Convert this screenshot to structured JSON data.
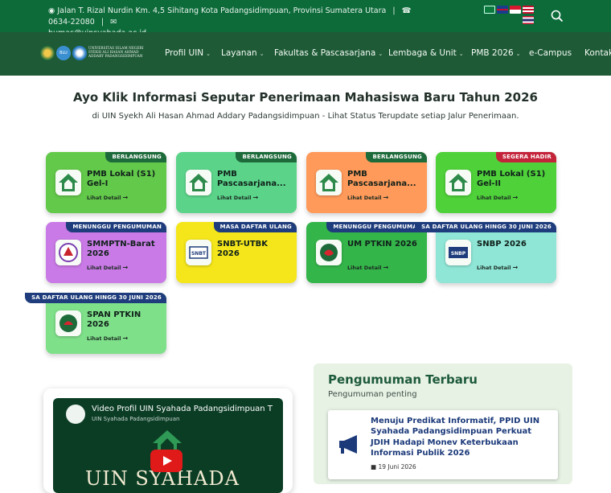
{
  "topbar": {
    "address": "Jalan T. Rizal Nurdin Km. 4,5 Sihitang Kota Padangsidimpuan, Provinsi Sumatera Utara",
    "separator": "|",
    "phone": "0634-22080",
    "email": "humas@uinsyahada.ac.id"
  },
  "logo": {
    "text": "UNIVERSITAS ISLAM NEGERI SYEKH ALI HASAN AHMAD ADDARY PADANGSIDIMPUAN",
    "blu": "BLU"
  },
  "nav": {
    "items": [
      {
        "label": "Profil UIN",
        "dropdown": true
      },
      {
        "label": "Layanan",
        "dropdown": true
      },
      {
        "label": "Fakultas & Pascasarjana",
        "dropdown": true
      },
      {
        "label": "Lembaga & Unit",
        "dropdown": true
      },
      {
        "label": "PMB 2026",
        "dropdown": true
      },
      {
        "label": "e-Campus",
        "dropdown": false
      },
      {
        "label": "Kontak",
        "dropdown": false
      }
    ]
  },
  "hero": {
    "title": "Ayo Klik Informasi Seputar Penerimaan Mahasiswa Baru Tahun 2026",
    "subtitle": "di UIN Syekh Ali Hasan Ahmad Addary Padangsidimpuan - Lihat Status Terupdate setiap Jalur Penerimaan."
  },
  "cards": [
    {
      "title": "PMB Lokal (S1) Gel-I",
      "badge": "BERLANGSUNG",
      "link": "Lihat Detail",
      "bg": "#63c94a",
      "badge_bg": "#1d6a3a",
      "icon": "uin-logo-icon"
    },
    {
      "title": "PMB Pascasarjana...",
      "badge": "BERLANGSUNG",
      "link": "Lihat Detail",
      "bg": "#5bd48a",
      "badge_bg": "#1d6a3a",
      "icon": "uin-logo-icon"
    },
    {
      "title": "PMB Pascasarjana...",
      "badge": "BERLANGSUNG",
      "link": "Lihat Detail",
      "bg": "#ff9a5a",
      "badge_bg": "#1d6a3a",
      "icon": "uin-logo-icon"
    },
    {
      "title": "PMB Lokal (S1) Gel-II",
      "badge": "SEGERA HADIR",
      "link": "Lihat Detail",
      "bg": "#4fd13a",
      "badge_bg": "#c4243a",
      "icon": "uin-logo-icon"
    },
    {
      "title": "SMMPTN-Barat 2026",
      "badge": "MENUNGGU PENGUMUMAN",
      "link": "Lihat Detail",
      "bg": "#c97ae6",
      "badge_bg": "#1f3d7c",
      "icon": "smmptn-logo-icon"
    },
    {
      "title": "SNBT-UTBK 2026",
      "badge": "MASA DAFTAR ULANG",
      "link": "",
      "bg": "#f4e61a",
      "badge_bg": "#1f3d7c",
      "icon": "snbt-logo-icon"
    },
    {
      "title": "UM PTKIN 2026",
      "badge": "MENUNGGU PENGUMUMAN",
      "link": "Lihat Detail",
      "bg": "#34b54a",
      "badge_bg": "#1f3d7c",
      "icon": "umptkin-logo-icon"
    },
    {
      "title": "SNBP 2026",
      "badge": "SA DAFTAR ULANG HINGG 30 JUNI 2026",
      "link": "Lihat Detail",
      "bg": "#8fe6d6",
      "badge_bg": "#1f3d7c",
      "icon": "snbp-logo-icon"
    },
    {
      "title": "SPAN PTKIN 2026",
      "badge": "SA DAFTAR ULANG HINGG 30 JUNI 2026",
      "link": "Lihat Detail",
      "bg": "#7fe08a",
      "badge_bg": "#1f3d7c",
      "icon": "span-logo-icon"
    }
  ],
  "video": {
    "title": "Video Profil UIN Syahada Padangsidimpuan T",
    "channel": "UIN Syahada Padangsidimpuan",
    "overlay_text": "UIN SYAHADA"
  },
  "announcements": {
    "heading": "Pengumuman Terbaru",
    "subheading": "Pengumuman penting",
    "items": [
      {
        "title": "Menuju Predikat Informatif, PPID UIN Syahada Padangsidimpuan Perkuat JDIH Hadapi Monev Keterbukaan Informasi Publik 2026",
        "date": "19 Juni 2026"
      }
    ]
  },
  "colors": {
    "topbar": "#0d6b3a",
    "navbar": "#1e5a36",
    "accent": "#1d5a3c"
  }
}
